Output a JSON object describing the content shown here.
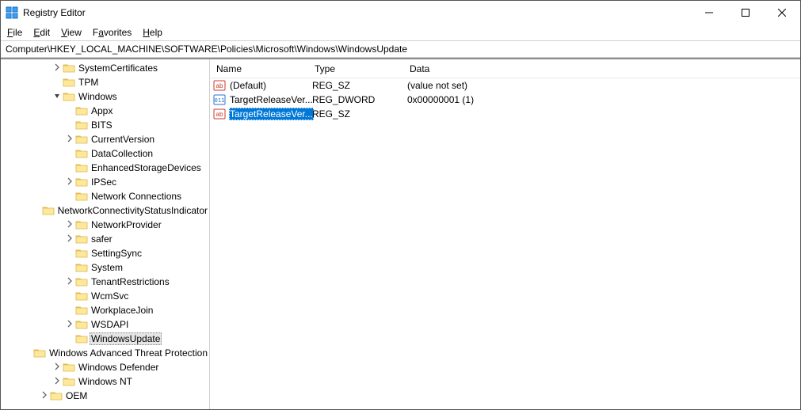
{
  "window": {
    "title": "Registry Editor"
  },
  "menu": {
    "file": "File",
    "edit": "Edit",
    "view": "View",
    "favorites": "Favorites",
    "help": "Help"
  },
  "address": "Computer\\HKEY_LOCAL_MACHINE\\SOFTWARE\\Policies\\Microsoft\\Windows\\WindowsUpdate",
  "tree": [
    {
      "indent": 4,
      "exp": ">",
      "label": "SystemCertificates"
    },
    {
      "indent": 4,
      "exp": "",
      "label": "TPM"
    },
    {
      "indent": 4,
      "exp": "v",
      "label": "Windows"
    },
    {
      "indent": 5,
      "exp": "",
      "label": "Appx"
    },
    {
      "indent": 5,
      "exp": "",
      "label": "BITS"
    },
    {
      "indent": 5,
      "exp": ">",
      "label": "CurrentVersion"
    },
    {
      "indent": 5,
      "exp": "",
      "label": "DataCollection"
    },
    {
      "indent": 5,
      "exp": "",
      "label": "EnhancedStorageDevices"
    },
    {
      "indent": 5,
      "exp": ">",
      "label": "IPSec"
    },
    {
      "indent": 5,
      "exp": "",
      "label": "Network Connections"
    },
    {
      "indent": 5,
      "exp": "",
      "label": "NetworkConnectivityStatusIndicator"
    },
    {
      "indent": 5,
      "exp": ">",
      "label": "NetworkProvider"
    },
    {
      "indent": 5,
      "exp": ">",
      "label": "safer"
    },
    {
      "indent": 5,
      "exp": "",
      "label": "SettingSync"
    },
    {
      "indent": 5,
      "exp": "",
      "label": "System"
    },
    {
      "indent": 5,
      "exp": ">",
      "label": "TenantRestrictions"
    },
    {
      "indent": 5,
      "exp": "",
      "label": "WcmSvc"
    },
    {
      "indent": 5,
      "exp": "",
      "label": "WorkplaceJoin"
    },
    {
      "indent": 5,
      "exp": ">",
      "label": "WSDAPI"
    },
    {
      "indent": 5,
      "exp": "",
      "label": "WindowsUpdate",
      "selected": true
    },
    {
      "indent": 4,
      "exp": "",
      "label": "Windows Advanced Threat Protection"
    },
    {
      "indent": 4,
      "exp": ">",
      "label": "Windows Defender"
    },
    {
      "indent": 4,
      "exp": ">",
      "label": "Windows NT"
    },
    {
      "indent": 3,
      "exp": ">",
      "label": "OEM"
    }
  ],
  "columns": {
    "name": "Name",
    "type": "Type",
    "data": "Data"
  },
  "colwidths": {
    "name": 124,
    "type": 120,
    "data": 400
  },
  "rows": [
    {
      "icon": "string",
      "name": "(Default)",
      "type": "REG_SZ",
      "data": "(value not set)"
    },
    {
      "icon": "binary",
      "name": "TargetReleaseVer...",
      "type": "REG_DWORD",
      "data": "0x00000001 (1)"
    },
    {
      "icon": "string",
      "name": "TargetReleaseVer...",
      "type": "REG_SZ",
      "data": "",
      "selected": true
    }
  ]
}
